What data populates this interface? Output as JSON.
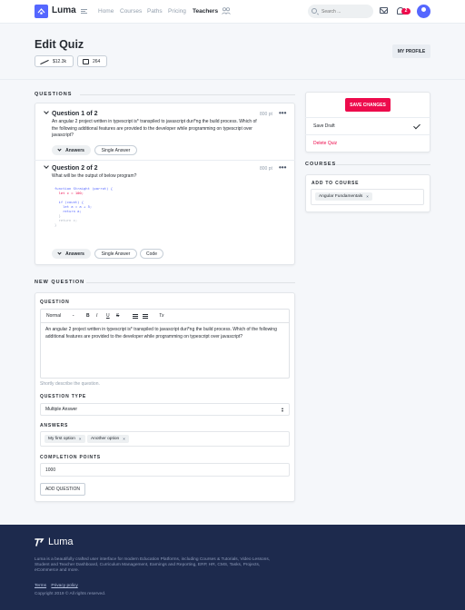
{
  "nav": {
    "brand": "Luma",
    "links": [
      "Home",
      "Courses",
      "Paths",
      "Pricing",
      "Teachers"
    ],
    "active_link": "Teachers",
    "search_placeholder": "Search ...",
    "notification_count": "2"
  },
  "header": {
    "title": "Edit Quiz",
    "earnings": "$12.3k",
    "count": "264",
    "profile_button": "MY PROFILE"
  },
  "questions": {
    "section_title": "QUESTIONS",
    "items": [
      {
        "title": "Question 1 of 2",
        "points": "800 pt",
        "text": "An angular 2 project written in typescript is* transpiled to javascript duri*ng the build process. Which of the following additional features are provided to the developer while programming on typescript over javascript?",
        "answers_label": "Answers",
        "tags": [
          "Single Answer"
        ]
      },
      {
        "title": "Question 2 of 2",
        "points": "800 pt",
        "text": "What will be the output of below program?",
        "code": [
          "function Straight (parrot) {",
          "  let c = 100;",
          "",
          "  if (count) {",
          "    let a = a + 5;",
          "    return a;",
          "  }",
          "  return c;",
          "}"
        ],
        "answers_label": "Answers",
        "tags": [
          "Single Answer",
          "Code"
        ]
      }
    ]
  },
  "sidebar": {
    "save_button": "SAVE CHANGES",
    "save_draft": "Save Draft",
    "delete_quiz": "Delete Quiz",
    "courses_title": "COURSES",
    "add_to_course": "ADD TO COURSE",
    "course_tag": "Angular Fundamentals"
  },
  "new_question": {
    "section_title": "NEW QUESTION",
    "question_label": "QUESTION",
    "toolbar": {
      "format": "Normal",
      "bold": "B",
      "italic": "I",
      "underline": "U",
      "strike": "S",
      "clear": "Tx"
    },
    "question_text": "An angular 2 project written in typescript is* transpiled to javascript duri*ng the build process. Which of the following additional features are provided to the developer while programming on typescript over javascript?",
    "hint": "Shortly describe the question.",
    "type_label": "QUESTION TYPE",
    "type_value": "Multiple Answer",
    "answers_label": "ANSWERS",
    "answer_tags": [
      "My first option",
      "Another option"
    ],
    "points_label": "COMPLETION POINTS",
    "points_value": "1000",
    "add_button": "ADD QUESTION"
  },
  "footer": {
    "brand": "Luma",
    "description": "Luma is a beautifully crafted user interface for modern Education Platforms, including Courses & Tutorials, Video Lessons, Student and Teacher Dashboard, Curriculum Management, Earnings and Reporting, ERP, HR, CMS, Tasks, Projects, eCommerce and more.",
    "terms": "Terms",
    "privacy": "Privacy policy",
    "copyright": "Copyright 2019 © All rights reserved."
  },
  "colors": {
    "primary": "#5567ff",
    "accent": "#ed0b4c",
    "footer_bg": "#1d2a4d"
  },
  "icons": [
    "menu-icon",
    "people-icon",
    "search-icon",
    "mail-icon",
    "bell-icon",
    "trend-icon",
    "box-icon",
    "check-icon",
    "chevron-down-icon",
    "more-icon"
  ]
}
